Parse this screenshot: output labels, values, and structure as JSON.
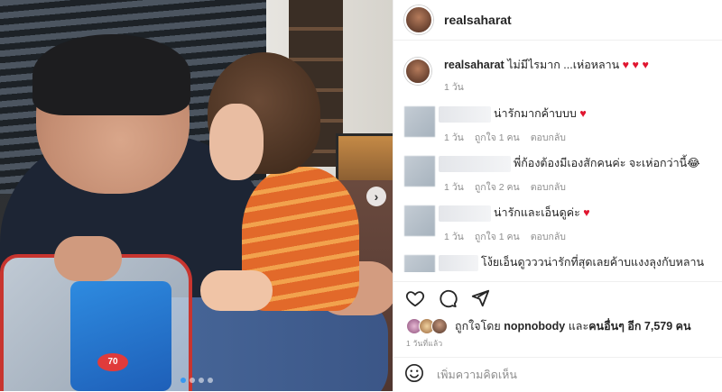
{
  "post": {
    "username": "realsaharat",
    "carousel_dots": 4,
    "carousel_active_index": 0
  },
  "caption": {
    "username": "realsaharat",
    "text": "ไม่มีไรมาก ...เห่อหลาน",
    "hearts": "♥ ♥ ♥",
    "time": "1 วัน"
  },
  "comments": [
    {
      "text": "น่ารักมากค้าบบบ",
      "heart": "♥",
      "time": "1 วัน",
      "likes": "ถูกใจ 1 คน",
      "reply": "ตอบกลับ"
    },
    {
      "text": "พี่ก้องต้องมีเองสักคนค่ะ จะเห่อกว่านี้😂",
      "heart": "",
      "time": "1 วัน",
      "likes": "ถูกใจ 2 คน",
      "reply": "ตอบกลับ"
    },
    {
      "text": "น่ารักและเอ็นดูค่ะ",
      "heart": "♥",
      "time": "1 วัน",
      "likes": "ถูกใจ 1 คน",
      "reply": "ตอบกลับ"
    },
    {
      "text": "โง้ยเอ็นดูวววน่ารักที่สุดเลยค้าบแงงลุงกับหลานแบบน่ารักมากกก",
      "heart": "♥ ♥ ♥",
      "time": "",
      "likes": "",
      "reply": ""
    }
  ],
  "actions": {
    "like_icon": "heart-outline-icon",
    "comment_icon": "speech-bubble-icon",
    "share_icon": "paper-plane-icon"
  },
  "likes": {
    "prefix": "ถูกใจโดย",
    "user": "nopnobody",
    "and": "และ",
    "others": "คนอื่นๆ",
    "count": "อีก 7,579 คน"
  },
  "timestamp": "1 วันที่แล้ว",
  "add_comment": {
    "icon": "smiley-icon",
    "placeholder": "เพิ่มความคิดเห็น"
  },
  "photo": {
    "toy_badge": "70"
  },
  "colors": {
    "heart": "#e0152f",
    "link": "#3897f0",
    "muted": "#8e8e8e"
  }
}
